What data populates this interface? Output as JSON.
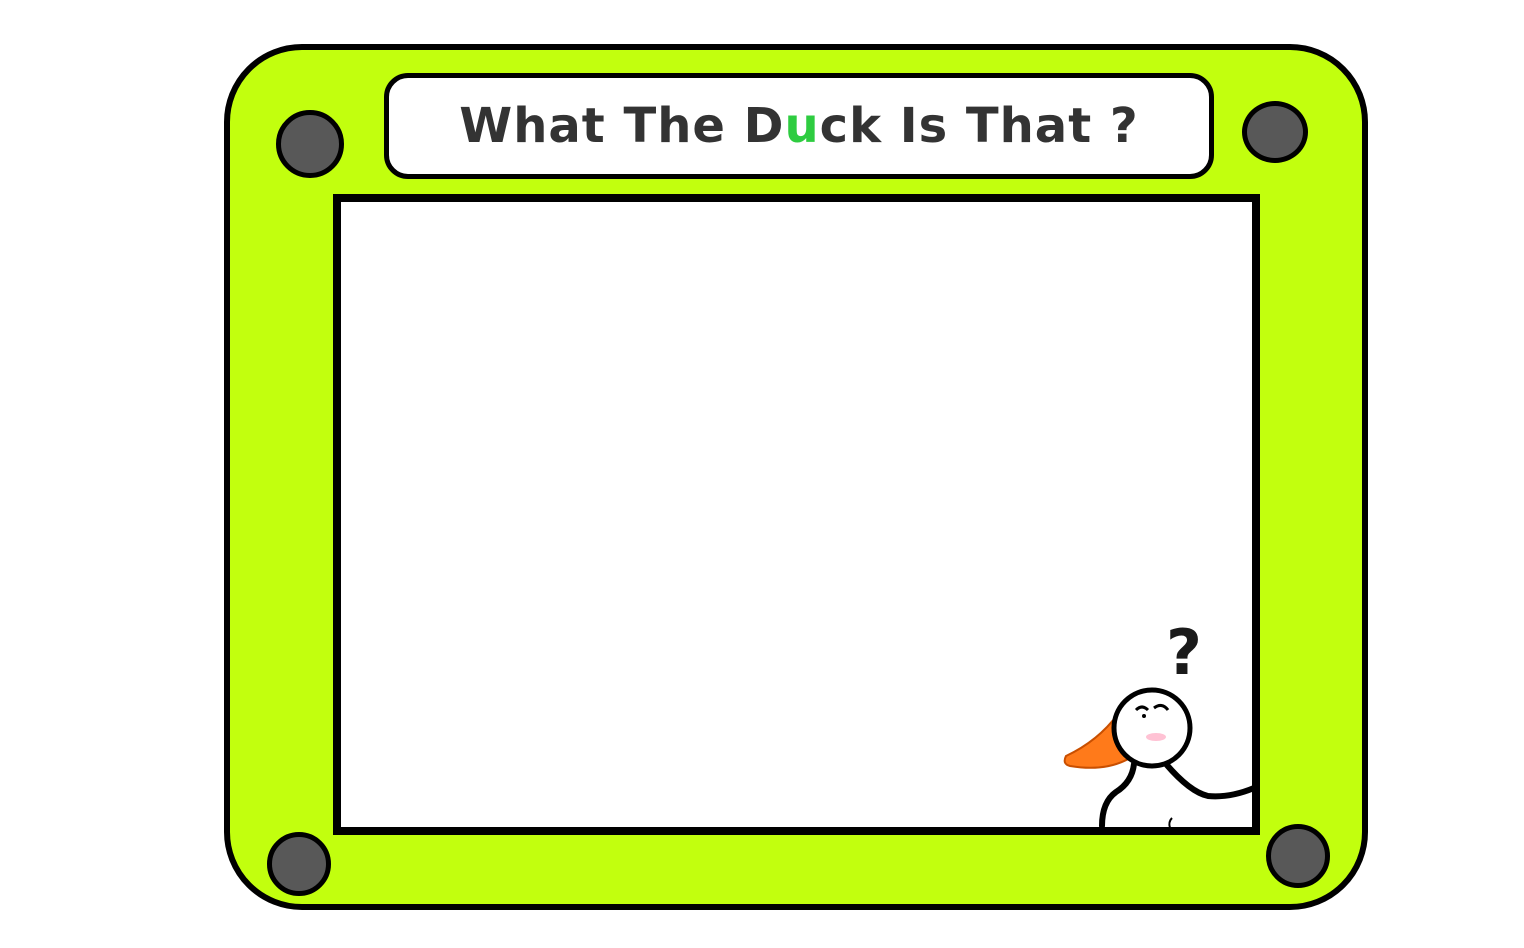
{
  "title": {
    "before": "What The D",
    "accent_letter": "u",
    "after": "ck Is That ?"
  },
  "mascot": {
    "question_mark": "?"
  },
  "colors": {
    "frame": "#c2ff0e",
    "accent": "#2ecc40",
    "knob": "#585858",
    "beak": "#ff7a1a"
  },
  "icons": {
    "mascot": "confused-duck-icon",
    "knobs": "knob-icon"
  }
}
